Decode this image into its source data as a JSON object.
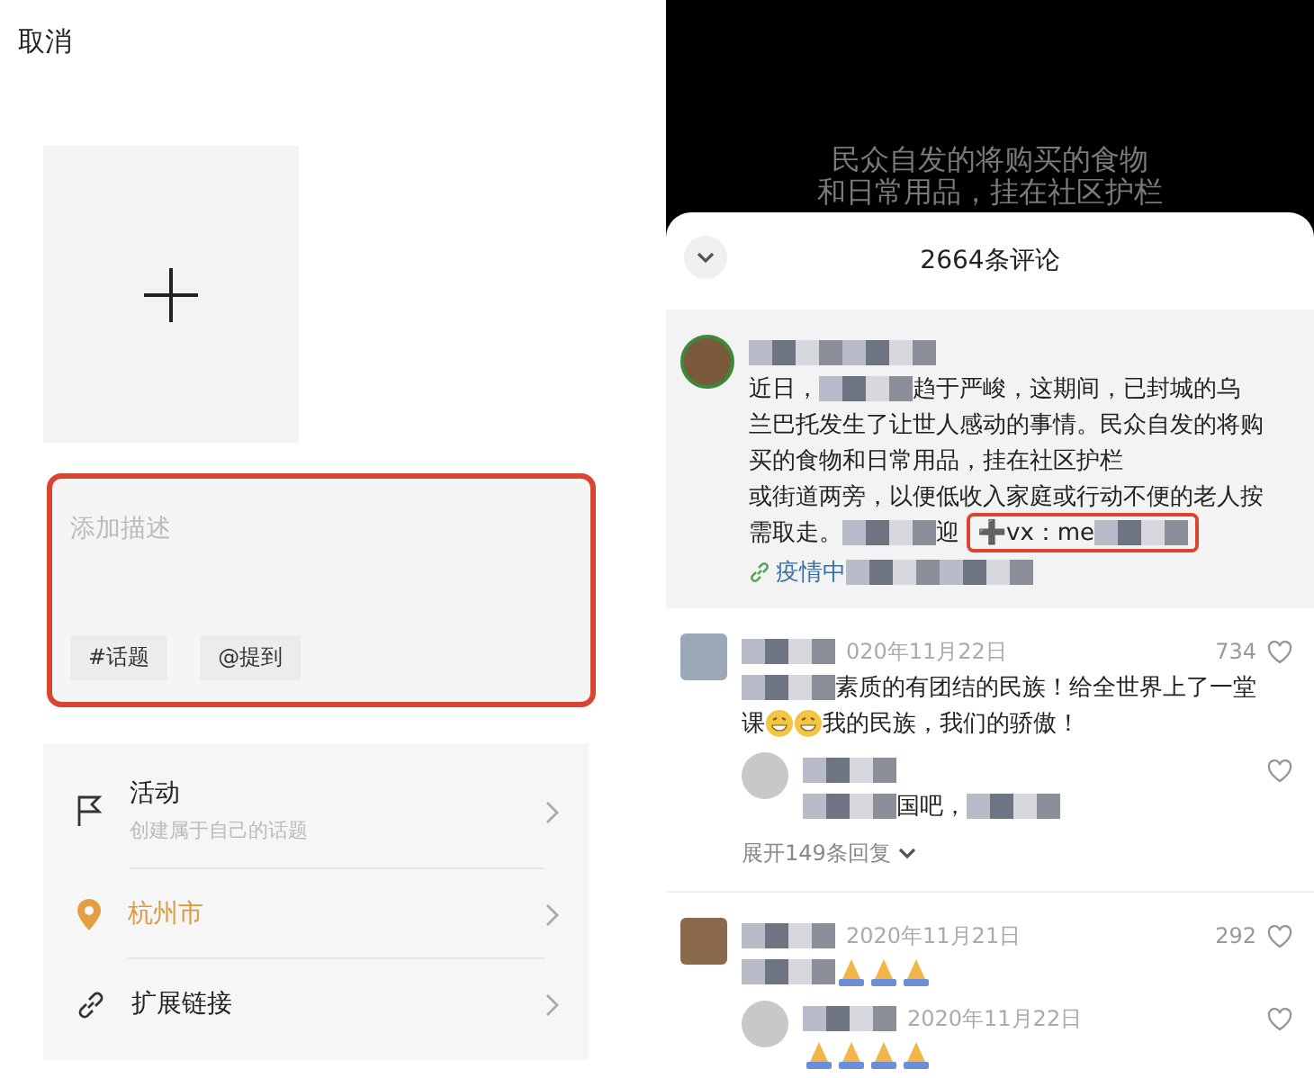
{
  "composer": {
    "cancel": "取消",
    "description": {
      "placeholder": "添加描述",
      "highlighted": true,
      "tags": [
        "#话题",
        "@提到"
      ]
    },
    "options": [
      {
        "kind": "activity",
        "title": "活动",
        "subtitle": "创建属于自己的话题"
      },
      {
        "kind": "location",
        "title": "杭州市"
      },
      {
        "kind": "link",
        "title": "扩展链接"
      }
    ]
  },
  "video": {
    "caption": [
      "民众自发的将购买的食物",
      "和日常用品，挂在社区护栏"
    ]
  },
  "comments": {
    "title": "2664条评论",
    "pinned": {
      "lines": [
        [
          {
            "kind": "text",
            "text": "近日，"
          },
          {
            "kind": "mosaic"
          },
          {
            "kind": "text",
            "text": "趋于严峻，这期间，已封城的乌"
          }
        ],
        [
          {
            "kind": "text",
            "text": "兰巴托发生了让世人感动的事情。民众自发的将购"
          }
        ],
        [
          {
            "kind": "text",
            "text": "买的食物和日常用品，挂在社区护栏"
          }
        ],
        [
          {
            "kind": "text",
            "text": "或街道两旁，以便低收入家庭或行动不便的老人按"
          }
        ],
        [
          {
            "kind": "text",
            "text": "需取走。"
          },
          {
            "kind": "mosaic"
          },
          {
            "kind": "text",
            "text": "迎"
          },
          {
            "kind": "contact",
            "highlighted": true,
            "text": "➕vx：me"
          }
        ]
      ],
      "link": "疫情中"
    },
    "items": [
      {
        "date": "020年11月22日",
        "likes": "734",
        "lines": [
          [
            {
              "kind": "mosaic"
            },
            {
              "kind": "text",
              "text": "素质的有团结的民族！给全世界上了一堂"
            }
          ],
          [
            {
              "kind": "text",
              "text": "课"
            },
            {
              "kind": "grin"
            },
            {
              "kind": "grin"
            },
            {
              "kind": "text",
              "text": "我的民族，我们的骄傲！"
            }
          ]
        ],
        "replies": [
          {
            "lines": [
              [
                {
                  "kind": "mosaic"
                },
                {
                  "kind": "text",
                  "text": "国吧，"
                },
                {
                  "kind": "mosaic"
                }
              ]
            ]
          }
        ],
        "more": "展开149条回复"
      },
      {
        "date": "2020年11月21日",
        "likes": "292",
        "lines": [
          [
            {
              "kind": "mosaic"
            },
            {
              "kind": "pray"
            },
            {
              "kind": "pray"
            },
            {
              "kind": "pray"
            }
          ]
        ],
        "replies": [
          {
            "date": "2020年11月22日",
            "lines": [
              [
                {
                  "kind": "pray"
                },
                {
                  "kind": "pray"
                },
                {
                  "kind": "pray"
                },
                {
                  "kind": "pray"
                }
              ]
            ]
          }
        ]
      }
    ]
  }
}
